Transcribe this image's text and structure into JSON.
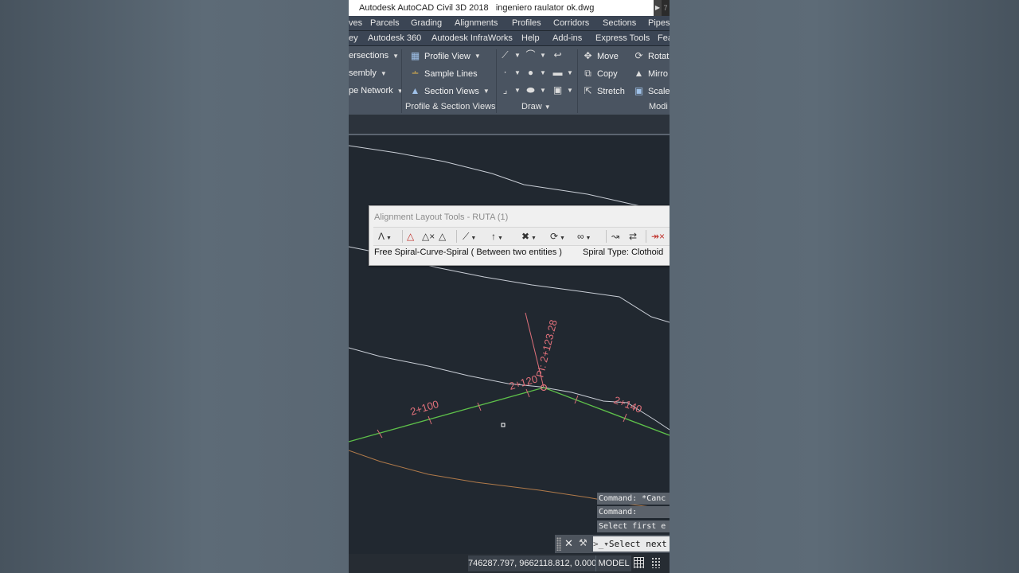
{
  "titlebar": {
    "app": "Autodesk AutoCAD Civil 3D 2018",
    "file": "ingeniero raulator ok.dwg",
    "overflow_glyph": "7"
  },
  "menu_row1": [
    "ves",
    "Parcels",
    "Grading",
    "Alignments",
    "Profiles",
    "Corridors",
    "Sections",
    "Pipes"
  ],
  "menu_row2": [
    "ey",
    "Autodesk 360",
    "Autodesk InfraWorks",
    "Help",
    "Add-ins",
    "Express Tools",
    "Fea"
  ],
  "ribbon": {
    "create": [
      "ersections",
      "sembly",
      "pe Network"
    ],
    "profile_section": {
      "items": [
        "Profile View",
        "Sample Lines",
        "Section Views"
      ],
      "panel": "Profile & Section Views"
    },
    "draw": {
      "panel": "Draw"
    },
    "modify": {
      "items": [
        "Move",
        "Copy",
        "Stretch",
        "Rotat",
        "Mirro",
        "Scale"
      ],
      "panel": "Modi"
    }
  },
  "alignment_toolbar": {
    "title": "Alignment Layout Tools - RUTA (1)",
    "mode": "Free Spiral-Curve-Spiral ( Between two entities )",
    "spiral_type": "Spiral Type: Clothoid"
  },
  "drawing": {
    "stations": [
      "2+100",
      "2+120",
      "2+140"
    ],
    "pi_label": "PI: 2+123.28",
    "colors": {
      "alignment": "#5ec14a",
      "label": "#e0707a",
      "terrain": "#c9ced6",
      "road_edge": "#b07a4a"
    }
  },
  "command": {
    "history": [
      "Command: *Canc",
      "Command:",
      "Select first e"
    ],
    "prompt": "Select next"
  },
  "status": {
    "coords": "746287.797, 9662118.812, 0.000",
    "space": "MODEL"
  }
}
